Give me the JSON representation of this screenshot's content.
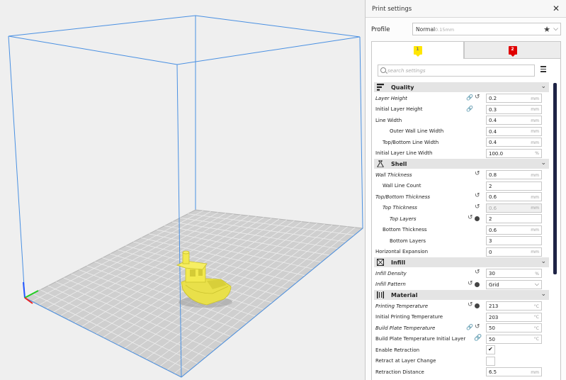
{
  "panel": {
    "title": "Print settings",
    "close_glyph": "✕",
    "profile_label": "Profile",
    "profile_name": "Normal",
    "profile_sub": "0.15mm",
    "star_glyph": "★",
    "chev_glyph": "⌵"
  },
  "tabs": [
    {
      "number": "1",
      "color": "#ffe600"
    },
    {
      "number": "2",
      "color": "#e00000"
    }
  ],
  "search": {
    "placeholder": "search settings"
  },
  "sections": {
    "quality": "Quality",
    "shell": "Shell",
    "infill": "Infill",
    "material": "Material"
  },
  "settings": {
    "layer_height": {
      "label": "Layer Height",
      "value": "0.2",
      "unit": "mm"
    },
    "initial_layer_height": {
      "label": "Initial Layer Height",
      "value": "0.3",
      "unit": "mm"
    },
    "line_width": {
      "label": "Line Width",
      "value": "0.4",
      "unit": "mm"
    },
    "outer_wall_line_width": {
      "label": "Outer Wall Line Width",
      "value": "0.4",
      "unit": "mm"
    },
    "top_bottom_line_width": {
      "label": "Top/Bottom Line Width",
      "value": "0.4",
      "unit": "mm"
    },
    "initial_layer_line_width": {
      "label": "Initial Layer Line Width",
      "value": "100.0",
      "unit": "%"
    },
    "wall_thickness": {
      "label": "Wall Thickness",
      "value": "0.8",
      "unit": "mm"
    },
    "wall_line_count": {
      "label": "Wall Line Count",
      "value": "2"
    },
    "top_bottom_thickness": {
      "label": "Top/Bottom Thickness",
      "value": "0.6",
      "unit": "mm"
    },
    "top_thickness": {
      "label": "Top Thickness",
      "value": "0.6",
      "unit": "mm"
    },
    "top_layers": {
      "label": "Top Layers",
      "value": "2"
    },
    "bottom_thickness": {
      "label": "Bottom Thickness",
      "value": "0.6",
      "unit": "mm"
    },
    "bottom_layers": {
      "label": "Bottom Layers",
      "value": "3"
    },
    "horizontal_expansion": {
      "label": "Horizontal Expansion",
      "value": "0",
      "unit": "mm"
    },
    "infill_density": {
      "label": "Infill Density",
      "value": "30",
      "unit": "%"
    },
    "infill_pattern": {
      "label": "Infill Pattern",
      "value": "Grid"
    },
    "printing_temperature": {
      "label": "Printing Temperature",
      "value": "213",
      "unit": "°C"
    },
    "initial_printing_temperature": {
      "label": "Initial Printing Temperature",
      "value": "203",
      "unit": "°C"
    },
    "build_plate_temperature": {
      "label": "Build Plate Temperature",
      "value": "50",
      "unit": "°C"
    },
    "build_plate_temperature_initial_layer": {
      "label": "Build Plate Temperature Initial Layer",
      "value": "50",
      "unit": "°C"
    },
    "enable_retraction": {
      "label": "Enable Retraction",
      "checked": true,
      "check_glyph": "✔"
    },
    "retract_at_layer_change": {
      "label": "Retract at Layer Change",
      "checked": false
    },
    "retraction_distance": {
      "label": "Retraction Distance",
      "value": "6.5",
      "unit": "mm"
    }
  },
  "glyphs": {
    "link": "🔗",
    "reset": "↺",
    "chevron": "⌄",
    "select_chev": "⌵"
  },
  "colors": {
    "build_volume_line": "#4a90e2",
    "model": "#f2e94e",
    "scroll_thumb": "#1e2345"
  }
}
